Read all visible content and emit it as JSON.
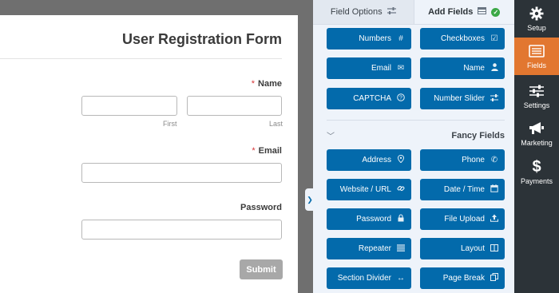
{
  "form": {
    "title": "User Registration Form",
    "name_label": "Name",
    "required_mark": "*",
    "first_sublabel": "First",
    "last_sublabel": "Last",
    "email_label": "Email",
    "password_label": "Password",
    "submit_label": "Submit"
  },
  "panel": {
    "tabs": [
      {
        "label": "Field Options",
        "icon": "sliders-icon"
      },
      {
        "label": "Add Fields",
        "icon": "table-icon",
        "status": "check-icon"
      }
    ],
    "standard_fields": [
      {
        "label": "Numbers",
        "icon": "hash-icon"
      },
      {
        "label": "Checkboxes",
        "icon": "checkbox-icon"
      },
      {
        "label": "Email",
        "icon": "envelope-icon"
      },
      {
        "label": "Name",
        "icon": "user-icon"
      },
      {
        "label": "CAPTCHA",
        "icon": "question-icon"
      },
      {
        "label": "Number Slider",
        "icon": "sliders-icon"
      }
    ],
    "fancy_section_title": "Fancy Fields",
    "fancy_fields": [
      {
        "label": "Address",
        "icon": "map-pin-icon"
      },
      {
        "label": "Phone",
        "icon": "phone-icon"
      },
      {
        "label": "Website / URL",
        "icon": "link-icon"
      },
      {
        "label": "Date / Time",
        "icon": "calendar-icon"
      },
      {
        "label": "Password",
        "icon": "lock-icon"
      },
      {
        "label": "File Upload",
        "icon": "upload-icon"
      },
      {
        "label": "Repeater",
        "icon": "list-icon"
      },
      {
        "label": "Layout",
        "icon": "columns-icon"
      },
      {
        "label": "Section Divider",
        "icon": "arrows-horizontal-icon"
      },
      {
        "label": "Page Break",
        "icon": "copy-icon"
      }
    ]
  },
  "nav": {
    "items": [
      {
        "label": "Setup",
        "icon": "gear-icon",
        "active": false
      },
      {
        "label": "Fields",
        "icon": "fields-list-icon",
        "active": true
      },
      {
        "label": "Settings",
        "icon": "sliders-icon",
        "active": false
      },
      {
        "label": "Marketing",
        "icon": "megaphone-icon",
        "active": false
      },
      {
        "label": "Payments",
        "icon": "dollar-icon",
        "active": false
      }
    ]
  },
  "colors": {
    "button_blue": "#036aab",
    "nav_dark": "#2c3338",
    "nav_active_orange": "#e27730",
    "required_red": "#d63638",
    "submit_gray": "#a8a8a8",
    "success_green": "#3ba846"
  }
}
